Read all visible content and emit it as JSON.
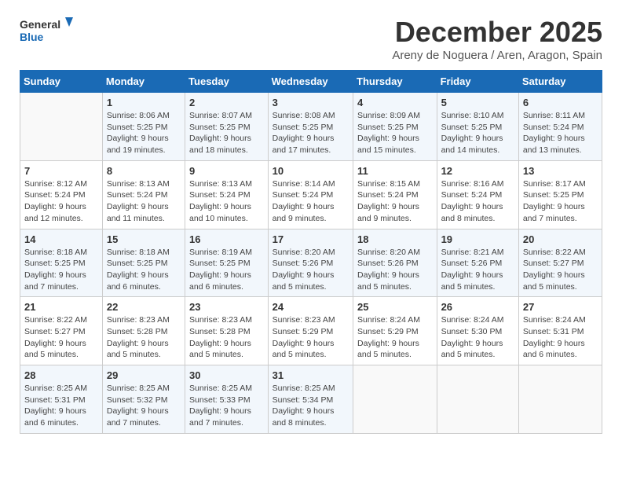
{
  "logo": {
    "line1": "General",
    "line2": "Blue"
  },
  "header": {
    "month": "December 2025",
    "location": "Areny de Noguera / Aren, Aragon, Spain"
  },
  "days_of_week": [
    "Sunday",
    "Monday",
    "Tuesday",
    "Wednesday",
    "Thursday",
    "Friday",
    "Saturday"
  ],
  "weeks": [
    [
      null,
      {
        "day": "1",
        "sunrise": "Sunrise: 8:06 AM",
        "sunset": "Sunset: 5:25 PM",
        "daylight": "Daylight: 9 hours and 19 minutes."
      },
      {
        "day": "2",
        "sunrise": "Sunrise: 8:07 AM",
        "sunset": "Sunset: 5:25 PM",
        "daylight": "Daylight: 9 hours and 18 minutes."
      },
      {
        "day": "3",
        "sunrise": "Sunrise: 8:08 AM",
        "sunset": "Sunset: 5:25 PM",
        "daylight": "Daylight: 9 hours and 17 minutes."
      },
      {
        "day": "4",
        "sunrise": "Sunrise: 8:09 AM",
        "sunset": "Sunset: 5:25 PM",
        "daylight": "Daylight: 9 hours and 15 minutes."
      },
      {
        "day": "5",
        "sunrise": "Sunrise: 8:10 AM",
        "sunset": "Sunset: 5:25 PM",
        "daylight": "Daylight: 9 hours and 14 minutes."
      },
      {
        "day": "6",
        "sunrise": "Sunrise: 8:11 AM",
        "sunset": "Sunset: 5:24 PM",
        "daylight": "Daylight: 9 hours and 13 minutes."
      }
    ],
    [
      {
        "day": "7",
        "sunrise": "Sunrise: 8:12 AM",
        "sunset": "Sunset: 5:24 PM",
        "daylight": "Daylight: 9 hours and 12 minutes."
      },
      {
        "day": "8",
        "sunrise": "Sunrise: 8:13 AM",
        "sunset": "Sunset: 5:24 PM",
        "daylight": "Daylight: 9 hours and 11 minutes."
      },
      {
        "day": "9",
        "sunrise": "Sunrise: 8:13 AM",
        "sunset": "Sunset: 5:24 PM",
        "daylight": "Daylight: 9 hours and 10 minutes."
      },
      {
        "day": "10",
        "sunrise": "Sunrise: 8:14 AM",
        "sunset": "Sunset: 5:24 PM",
        "daylight": "Daylight: 9 hours and 9 minutes."
      },
      {
        "day": "11",
        "sunrise": "Sunrise: 8:15 AM",
        "sunset": "Sunset: 5:24 PM",
        "daylight": "Daylight: 9 hours and 9 minutes."
      },
      {
        "day": "12",
        "sunrise": "Sunrise: 8:16 AM",
        "sunset": "Sunset: 5:24 PM",
        "daylight": "Daylight: 9 hours and 8 minutes."
      },
      {
        "day": "13",
        "sunrise": "Sunrise: 8:17 AM",
        "sunset": "Sunset: 5:25 PM",
        "daylight": "Daylight: 9 hours and 7 minutes."
      }
    ],
    [
      {
        "day": "14",
        "sunrise": "Sunrise: 8:18 AM",
        "sunset": "Sunset: 5:25 PM",
        "daylight": "Daylight: 9 hours and 7 minutes."
      },
      {
        "day": "15",
        "sunrise": "Sunrise: 8:18 AM",
        "sunset": "Sunset: 5:25 PM",
        "daylight": "Daylight: 9 hours and 6 minutes."
      },
      {
        "day": "16",
        "sunrise": "Sunrise: 8:19 AM",
        "sunset": "Sunset: 5:25 PM",
        "daylight": "Daylight: 9 hours and 6 minutes."
      },
      {
        "day": "17",
        "sunrise": "Sunrise: 8:20 AM",
        "sunset": "Sunset: 5:26 PM",
        "daylight": "Daylight: 9 hours and 5 minutes."
      },
      {
        "day": "18",
        "sunrise": "Sunrise: 8:20 AM",
        "sunset": "Sunset: 5:26 PM",
        "daylight": "Daylight: 9 hours and 5 minutes."
      },
      {
        "day": "19",
        "sunrise": "Sunrise: 8:21 AM",
        "sunset": "Sunset: 5:26 PM",
        "daylight": "Daylight: 9 hours and 5 minutes."
      },
      {
        "day": "20",
        "sunrise": "Sunrise: 8:22 AM",
        "sunset": "Sunset: 5:27 PM",
        "daylight": "Daylight: 9 hours and 5 minutes."
      }
    ],
    [
      {
        "day": "21",
        "sunrise": "Sunrise: 8:22 AM",
        "sunset": "Sunset: 5:27 PM",
        "daylight": "Daylight: 9 hours and 5 minutes."
      },
      {
        "day": "22",
        "sunrise": "Sunrise: 8:23 AM",
        "sunset": "Sunset: 5:28 PM",
        "daylight": "Daylight: 9 hours and 5 minutes."
      },
      {
        "day": "23",
        "sunrise": "Sunrise: 8:23 AM",
        "sunset": "Sunset: 5:28 PM",
        "daylight": "Daylight: 9 hours and 5 minutes."
      },
      {
        "day": "24",
        "sunrise": "Sunrise: 8:23 AM",
        "sunset": "Sunset: 5:29 PM",
        "daylight": "Daylight: 9 hours and 5 minutes."
      },
      {
        "day": "25",
        "sunrise": "Sunrise: 8:24 AM",
        "sunset": "Sunset: 5:29 PM",
        "daylight": "Daylight: 9 hours and 5 minutes."
      },
      {
        "day": "26",
        "sunrise": "Sunrise: 8:24 AM",
        "sunset": "Sunset: 5:30 PM",
        "daylight": "Daylight: 9 hours and 5 minutes."
      },
      {
        "day": "27",
        "sunrise": "Sunrise: 8:24 AM",
        "sunset": "Sunset: 5:31 PM",
        "daylight": "Daylight: 9 hours and 6 minutes."
      }
    ],
    [
      {
        "day": "28",
        "sunrise": "Sunrise: 8:25 AM",
        "sunset": "Sunset: 5:31 PM",
        "daylight": "Daylight: 9 hours and 6 minutes."
      },
      {
        "day": "29",
        "sunrise": "Sunrise: 8:25 AM",
        "sunset": "Sunset: 5:32 PM",
        "daylight": "Daylight: 9 hours and 7 minutes."
      },
      {
        "day": "30",
        "sunrise": "Sunrise: 8:25 AM",
        "sunset": "Sunset: 5:33 PM",
        "daylight": "Daylight: 9 hours and 7 minutes."
      },
      {
        "day": "31",
        "sunrise": "Sunrise: 8:25 AM",
        "sunset": "Sunset: 5:34 PM",
        "daylight": "Daylight: 9 hours and 8 minutes."
      },
      null,
      null,
      null
    ]
  ]
}
